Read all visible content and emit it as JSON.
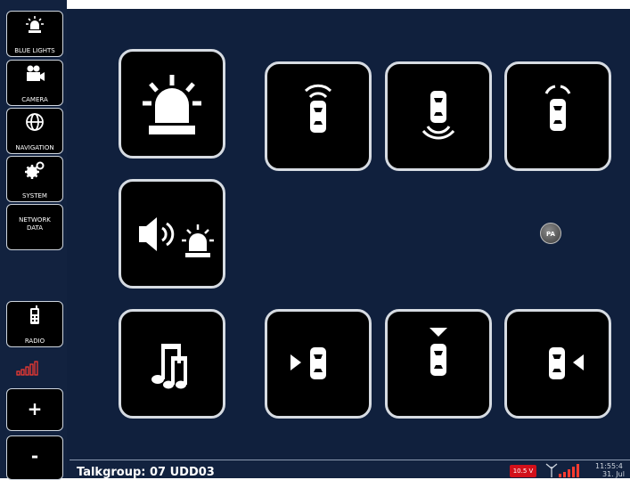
{
  "sidebar": {
    "blue_lights": "BLUE LIGHTS",
    "camera": "CAMERA",
    "navigation": "NAVIGATION",
    "system": "SYSTEM",
    "network_data": [
      "NETWORK",
      "DATA"
    ],
    "radio": "RADIO",
    "plus": "+",
    "minus": "-"
  },
  "pa_button": "PA",
  "status_bar": {
    "talkgroup": "Talkgroup: 07 UDD03",
    "battery": "10.5 V",
    "time": "11:55:4",
    "date": "31. Jul"
  },
  "colors": {
    "background": "#10203d",
    "sidebar": "#12223f",
    "tile": "#000000",
    "tile_border": "#d6dbe2",
    "battery": "#d2101a",
    "signal": "#ff3030"
  },
  "icons": {
    "tiles": [
      "siren-icon",
      "car-front-sensor-icon",
      "car-rear-sensor-icon",
      "car-corner-sensors-icon",
      "speaker-siren-icon",
      "music-icon",
      "car-arrow-left-icon",
      "car-arrow-top-icon",
      "car-arrow-right-icon"
    ]
  }
}
